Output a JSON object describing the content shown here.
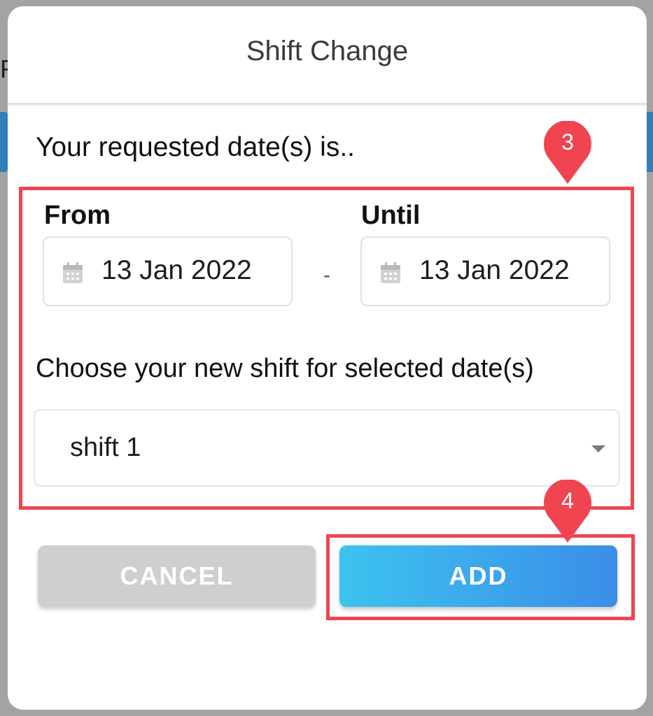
{
  "dialog": {
    "title": "Shift Change",
    "requested_label": "Your requested date(s) is..",
    "from": {
      "label": "From",
      "value": "13 Jan 2022",
      "icon": "calendar-icon"
    },
    "until": {
      "label": "Until",
      "value": "13 Jan 2022",
      "icon": "calendar-icon"
    },
    "range_separator": "-",
    "shift_prompt": "Choose your new shift for selected date(s)",
    "shift_select": {
      "selected": "shift 1",
      "icon": "caret-down-icon"
    },
    "buttons": {
      "cancel": "CANCEL",
      "add": "ADD"
    }
  },
  "annotations": {
    "step_fields": "3",
    "step_add": "4",
    "color": "#f04550"
  },
  "colors": {
    "add_gradient_start": "#3cc3ef",
    "add_gradient_end": "#3b8de8",
    "cancel_bg": "#cfcfcf"
  }
}
